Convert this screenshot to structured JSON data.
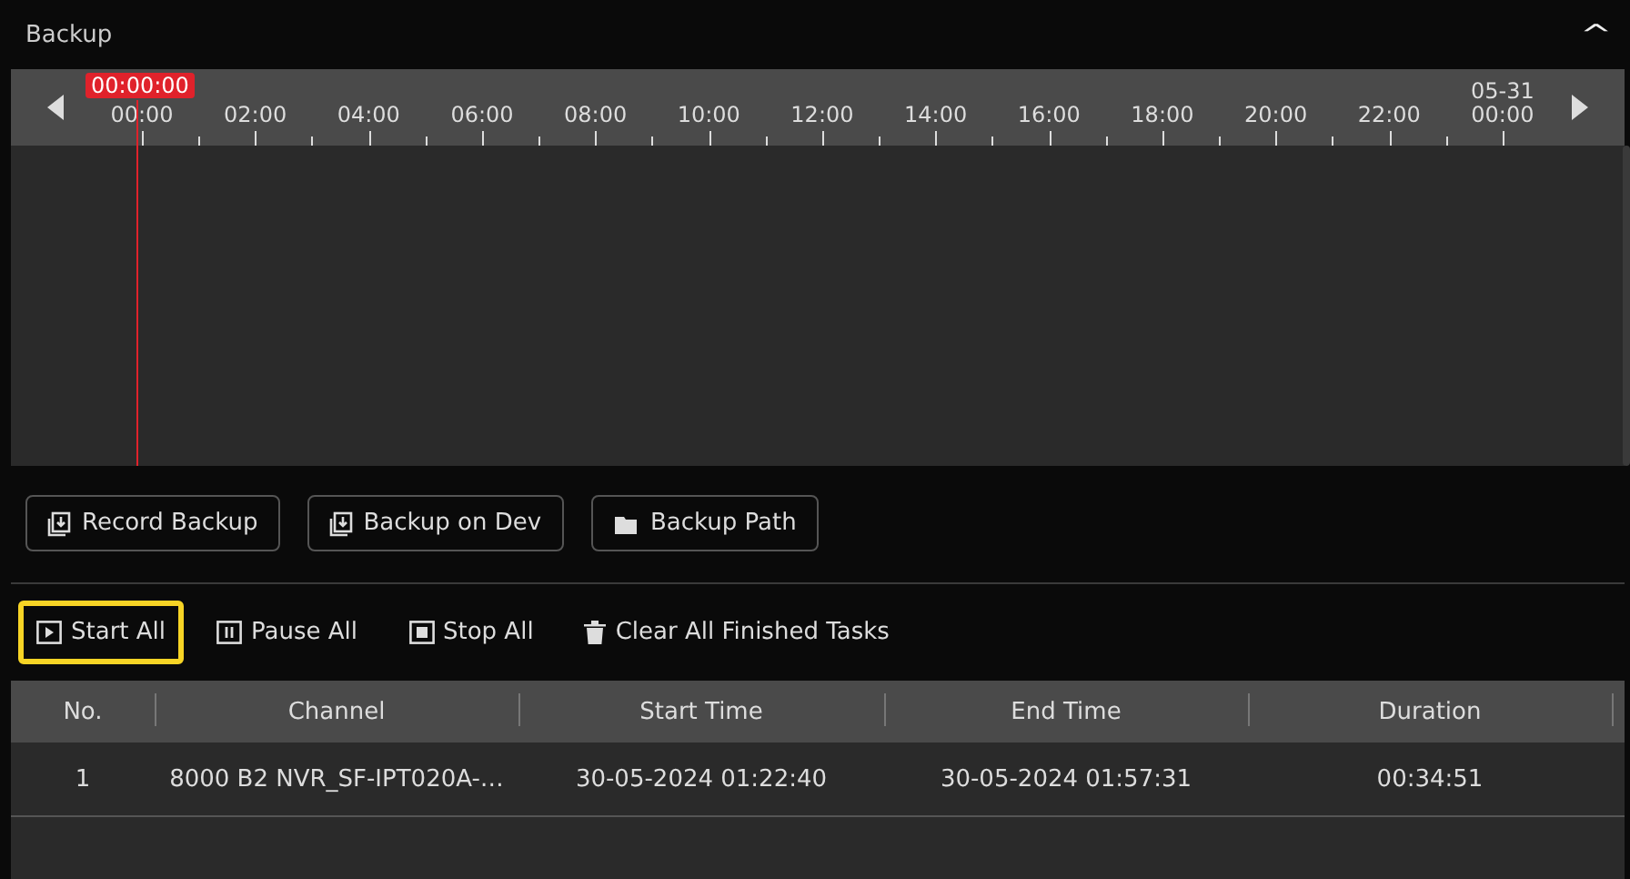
{
  "panel": {
    "title": "Backup",
    "collapse_icon": "^"
  },
  "timeline": {
    "cursor_time": "00:00:00",
    "date_label": "05-31",
    "hours": [
      "00:00",
      "02:00",
      "04:00",
      "06:00",
      "08:00",
      "10:00",
      "12:00",
      "14:00",
      "16:00",
      "18:00",
      "20:00",
      "22:00",
      "00:00"
    ]
  },
  "buttons": [
    {
      "label": "Record Backup",
      "kind": "download"
    },
    {
      "label": "Backup on Dev",
      "kind": "download"
    },
    {
      "label": "Backup Path",
      "kind": "folder"
    }
  ],
  "actions": [
    {
      "label": "Start All",
      "kind": "play",
      "highlighted": true
    },
    {
      "label": "Pause All",
      "kind": "pause",
      "highlighted": false
    },
    {
      "label": "Stop All",
      "kind": "stop",
      "highlighted": false
    },
    {
      "label": "Clear All Finished Tasks",
      "kind": "trash",
      "highlighted": false
    }
  ],
  "table": {
    "columns": [
      "No.",
      "Channel",
      "Start Time",
      "End Time",
      "Duration"
    ],
    "rows": [
      [
        "1",
        "8000 B2 NVR_SF-IPT020A-…",
        "30-05-2024 01:22:40",
        "30-05-2024 01:57:31",
        "00:34:51"
      ]
    ]
  }
}
